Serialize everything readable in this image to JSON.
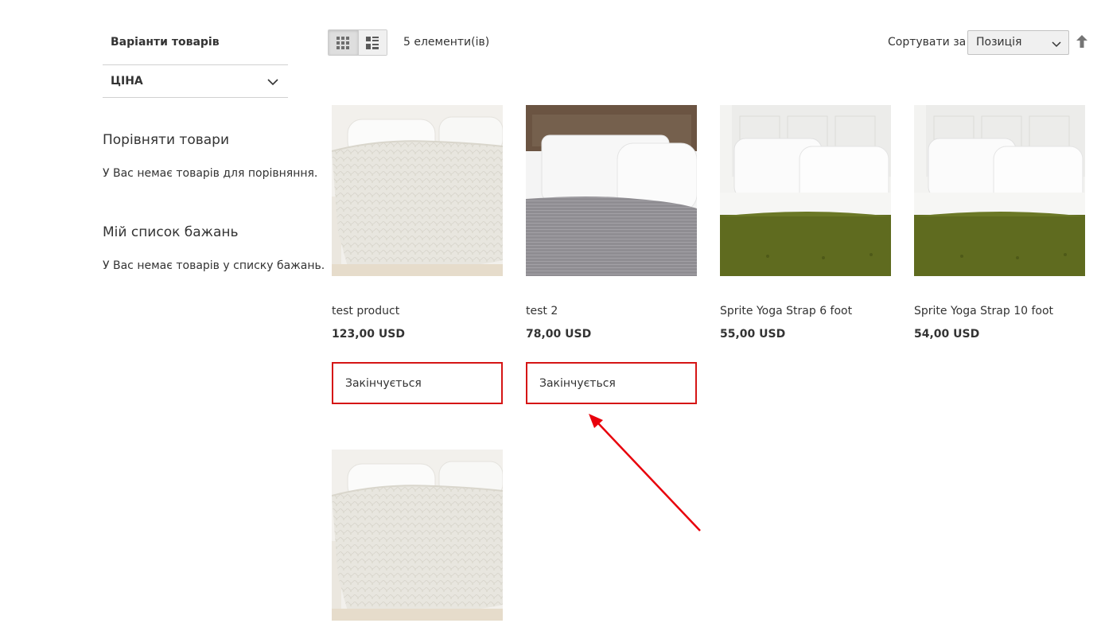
{
  "sidebar": {
    "filter_title": "Варіанти товарів",
    "filter_price_label": "ЦІНА",
    "compare_title": "Порівняти товари",
    "compare_empty": "У Вас немає товарів для порівняння.",
    "wishlist_title": "Мій список бажань",
    "wishlist_empty": "У Вас немає товарів у списку бажань."
  },
  "toolbar": {
    "view_modes": [
      {
        "icon": "grid-view-icon",
        "active": true
      },
      {
        "icon": "list-view-icon",
        "active": false
      }
    ],
    "amount": "5 елементи(ів)",
    "sort_label": "Сортувати за",
    "sort_value": "Позиція",
    "sort_direction_icon": "arrow-up-icon"
  },
  "products": [
    {
      "name": "test product",
      "price": "123,00 USD",
      "badge": "Закінчується",
      "image": "white-quilt-bed"
    },
    {
      "name": "test 2",
      "price": "78,00 USD",
      "badge": "Закінчується",
      "image": "gray-blanket-wood-headboard"
    },
    {
      "name": "Sprite Yoga Strap 6 foot",
      "price": "55,00 USD",
      "badge": null,
      "image": "olive-comforter-white-headboard"
    },
    {
      "name": "Sprite Yoga Strap 10 foot",
      "price": "54,00 USD",
      "badge": null,
      "image": "olive-comforter-white-headboard"
    },
    {
      "name": "",
      "price": "",
      "badge": null,
      "image": "white-quilt-bed"
    }
  ],
  "colors": {
    "badge_border": "#d51515",
    "annotation_arrow": "#e8000b"
  }
}
